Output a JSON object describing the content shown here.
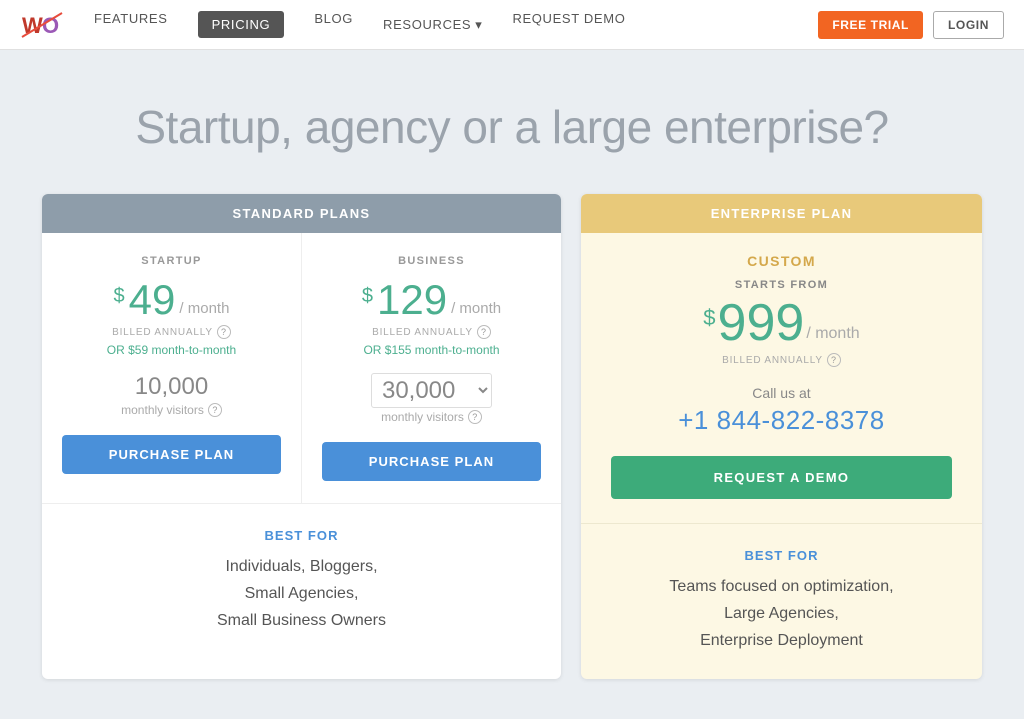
{
  "nav": {
    "links": [
      {
        "id": "features",
        "label": "FEATURES",
        "active": false
      },
      {
        "id": "pricing",
        "label": "PRICING",
        "active": true
      },
      {
        "id": "blog",
        "label": "BLOG",
        "active": false
      },
      {
        "id": "resources",
        "label": "RESOURCES",
        "active": false
      },
      {
        "id": "request-demo",
        "label": "REQUEST DEMO",
        "active": false
      }
    ],
    "free_trial_label": "FREE TRIAL",
    "login_label": "LOGIN"
  },
  "hero": {
    "title": "Startup, agency or a large enterprise?"
  },
  "standard_plans": {
    "header": "STANDARD PLANS",
    "startup": {
      "name": "STARTUP",
      "price_dollar": "$",
      "price_amount": "49",
      "price_period": "/ month",
      "billed": "BILLED ANNUALLY",
      "monthly_alt": "OR $59 month-to-month",
      "visitors": "10,000",
      "visitors_label": "monthly visitors",
      "purchase_label": "PURCHASE PLAN"
    },
    "business": {
      "name": "BUSINESS",
      "price_dollar": "$",
      "price_amount": "129",
      "price_period": "/ month",
      "billed": "BILLED ANNUALLY",
      "monthly_alt": "OR $155 month-to-month",
      "visitors": "30,000",
      "visitors_label": "monthly visitors",
      "purchase_label": "PURCHASE PLAN"
    },
    "best_for_label": "BEST FOR",
    "best_for_text": "Individuals, Bloggers,\nSmall Agencies,\nSmall Business Owners"
  },
  "enterprise_plan": {
    "header": "ENTERPRISE PLAN",
    "custom_label": "CUSTOM",
    "starts_from": "STARTS FROM",
    "price_dollar": "$",
    "price_amount": "999",
    "price_period": "/ month",
    "billed": "BILLED ANNUALLY",
    "call_text": "Call us at",
    "phone": "+1 844-822-8378",
    "request_demo_label": "REQUEST A DEMO",
    "best_for_label": "BEST FOR",
    "best_for_text": "Teams focused on optimization,\nLarge Agencies,\nEnterprise Deployment"
  },
  "icons": {
    "chevron_down": "▾",
    "question": "?"
  }
}
